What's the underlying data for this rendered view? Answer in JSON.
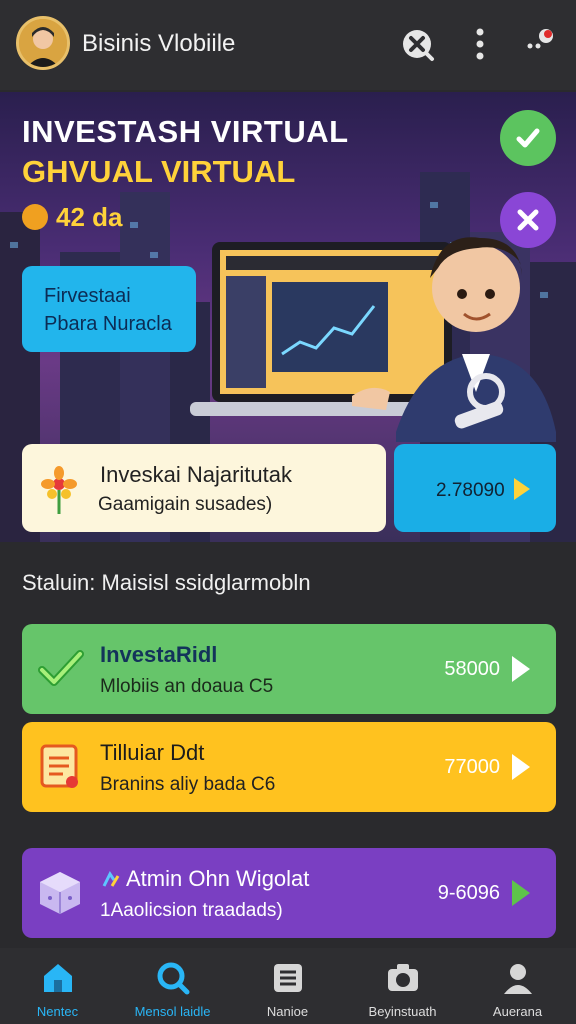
{
  "header": {
    "title": "Bisinis Vlobiile"
  },
  "hero": {
    "title_line1": "INVESTASH VIRTUAL",
    "title_line2": "GHVUAL VIRTUAL",
    "coin_text": "42 da",
    "blue_card_line1": "Firvestaai",
    "blue_card_line2": "Pbara Nuracla"
  },
  "info_card": {
    "title": "Inveskai Najaritutak",
    "subtitle": "Gaamigain susades)",
    "value": "2.78090"
  },
  "status_text": "Staluin: Maisisl ssidglarmobln",
  "rows": [
    {
      "title": "InvestaRidl",
      "subtitle": "Mlobiis an doaua C5",
      "value": "58000"
    },
    {
      "title": "Tilluiar Ddt",
      "subtitle": "Branins aliy bada C6",
      "value": "77000"
    },
    {
      "title": "Atmin Ohn Wigolat",
      "subtitle": "1Aaolicsion traadads)",
      "value": "9-6096"
    }
  ],
  "nav": [
    {
      "label": "Nentec",
      "active": true
    },
    {
      "label": "Mensol laidle",
      "active": true
    },
    {
      "label": "Nanioe",
      "active": false
    },
    {
      "label": "Beyinstuath",
      "active": false
    },
    {
      "label": "Auerana",
      "active": false
    }
  ],
  "colors": {
    "accent_blue": "#22b5ec",
    "green": "#66c56a",
    "yellow": "#ffc21f",
    "purple": "#7a3fc2",
    "nav_active": "#29b6f6"
  },
  "icons": {
    "search": "search-cross-icon",
    "more": "more-vertical-icon",
    "notifications": "notification-dots-icon"
  }
}
